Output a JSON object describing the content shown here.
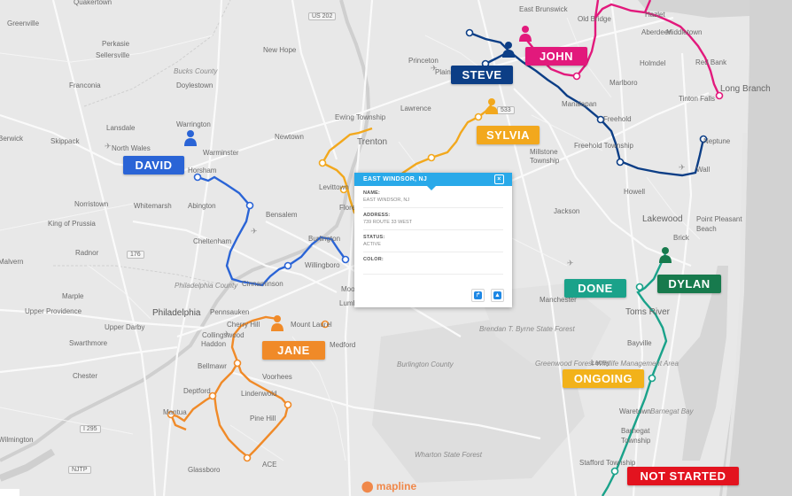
{
  "colors": {
    "david": "#2a64d6",
    "steve": "#0c3e86",
    "john": "#e2197c",
    "sylvia": "#f2a81d",
    "jane": "#f08a28",
    "dylan": "#177a4d",
    "done": "#1aa28a",
    "ongoing": "#f2b21a",
    "not_started": "#e3131f",
    "popup_header": "#29a9e9"
  },
  "reps": {
    "david": "DAVID",
    "steve": "STEVE",
    "john": "JOHN",
    "sylvia": "SYLVIA",
    "jane": "JANE",
    "dylan": "DYLAN"
  },
  "status_labels": {
    "done": "DONE",
    "ongoing": "ONGOING",
    "not_started": "NOT STARTED"
  },
  "popup": {
    "title": "EAST WINDSOR, NJ",
    "fields": [
      {
        "key": "NAME:",
        "value": "EAST WINDSOR, NJ"
      },
      {
        "key": "ADDRESS:",
        "value": "739 ROUTE 33 WEST"
      },
      {
        "key": "STATUS:",
        "value": "ACTIVE"
      },
      {
        "key": "COLOR:",
        "value": ""
      }
    ]
  },
  "brand": "mapline",
  "places": [
    {
      "name": "Quakertown",
      "cls": ""
    },
    {
      "name": "Greenville",
      "cls": ""
    },
    {
      "name": "Perkasie",
      "cls": ""
    },
    {
      "name": "Sellersville",
      "cls": ""
    },
    {
      "name": "Franconia",
      "cls": ""
    },
    {
      "name": "Bucks County",
      "cls": "it"
    },
    {
      "name": "Doylestown",
      "cls": ""
    },
    {
      "name": "New Hope",
      "cls": ""
    },
    {
      "name": "Princeton",
      "cls": ""
    },
    {
      "name": "Plainsboro",
      "cls": ""
    },
    {
      "name": "East Brunswick",
      "cls": ""
    },
    {
      "name": "Old Bridge",
      "cls": ""
    },
    {
      "name": "Hazlet",
      "cls": ""
    },
    {
      "name": "Aberdeen",
      "cls": ""
    },
    {
      "name": "Middletown",
      "cls": ""
    },
    {
      "name": "Holmdel",
      "cls": ""
    },
    {
      "name": "Red Bank",
      "cls": ""
    },
    {
      "name": "Long Branch",
      "cls": "lg"
    },
    {
      "name": "Tinton Falls",
      "cls": ""
    },
    {
      "name": "Marlboro",
      "cls": ""
    },
    {
      "name": "Manalapan",
      "cls": ""
    },
    {
      "name": "Freehold",
      "cls": ""
    },
    {
      "name": "Freehold Township",
      "cls": ""
    },
    {
      "name": "Neptune",
      "cls": ""
    },
    {
      "name": "Wall",
      "cls": ""
    },
    {
      "name": "Howell",
      "cls": ""
    },
    {
      "name": "Jackson",
      "cls": ""
    },
    {
      "name": "Lakewood",
      "cls": "lg"
    },
    {
      "name": "Point Pleasant",
      "cls": ""
    },
    {
      "name": "Beach",
      "cls": ""
    },
    {
      "name": "Brick",
      "cls": ""
    },
    {
      "name": "Toms River",
      "cls": "lg"
    },
    {
      "name": "Manchester",
      "cls": ""
    },
    {
      "name": "Bayville",
      "cls": ""
    },
    {
      "name": "Lacey",
      "cls": ""
    },
    {
      "name": "Waretown",
      "cls": ""
    },
    {
      "name": "Barnegat",
      "cls": ""
    },
    {
      "name": "Township",
      "cls": ""
    },
    {
      "name": "Barnegat Bay",
      "cls": "it"
    },
    {
      "name": "Stafford Township",
      "cls": ""
    },
    {
      "name": "Millstone",
      "cls": ""
    },
    {
      "name": "Township",
      "cls": ""
    },
    {
      "name": "Lawrence",
      "cls": ""
    },
    {
      "name": "Ewing Township",
      "cls": ""
    },
    {
      "name": "Trenton",
      "cls": "lg"
    },
    {
      "name": "Newtown",
      "cls": ""
    },
    {
      "name": "Warrington",
      "cls": ""
    },
    {
      "name": "Warminster",
      "cls": ""
    },
    {
      "name": "Lansdale",
      "cls": ""
    },
    {
      "name": "North Wales",
      "cls": ""
    },
    {
      "name": "Skippack",
      "cls": ""
    },
    {
      "name": "Horsham",
      "cls": ""
    },
    {
      "name": "Abington",
      "cls": ""
    },
    {
      "name": "Whitemarsh",
      "cls": ""
    },
    {
      "name": "Norristown",
      "cls": ""
    },
    {
      "name": "King of Prussia",
      "cls": ""
    },
    {
      "name": "Radnor",
      "cls": ""
    },
    {
      "name": "Bensalem",
      "cls": ""
    },
    {
      "name": "Cheltenham",
      "cls": ""
    },
    {
      "name": "Burlington",
      "cls": ""
    },
    {
      "name": "Willingboro",
      "cls": ""
    },
    {
      "name": "Cinnaminson",
      "cls": ""
    },
    {
      "name": "Levittown",
      "cls": ""
    },
    {
      "name": "Florence",
      "cls": ""
    },
    {
      "name": "Philadelphia County",
      "cls": "it"
    },
    {
      "name": "Philadelphia",
      "cls": "big"
    },
    {
      "name": "Pennsauken",
      "cls": ""
    },
    {
      "name": "Mount Laurel",
      "cls": ""
    },
    {
      "name": "Cherry Hill",
      "cls": ""
    },
    {
      "name": "Collingswood",
      "cls": ""
    },
    {
      "name": "Haddon",
      "cls": ""
    },
    {
      "name": "Bellmawr",
      "cls": ""
    },
    {
      "name": "Voorhees",
      "cls": ""
    },
    {
      "name": "Medford",
      "cls": ""
    },
    {
      "name": "Marple",
      "cls": ""
    },
    {
      "name": "Upper Providence",
      "cls": ""
    },
    {
      "name": "Upper Darby",
      "cls": ""
    },
    {
      "name": "Swarthmore",
      "cls": ""
    },
    {
      "name": "Chester",
      "cls": ""
    },
    {
      "name": "Deptford",
      "cls": ""
    },
    {
      "name": "Lindenwold",
      "cls": ""
    },
    {
      "name": "Mantua",
      "cls": ""
    },
    {
      "name": "Pine Hill",
      "cls": ""
    },
    {
      "name": "Glassboro",
      "cls": ""
    },
    {
      "name": "ACE",
      "cls": ""
    },
    {
      "name": "Burlington County",
      "cls": "it"
    },
    {
      "name": "Wharton State Forest",
      "cls": "it"
    },
    {
      "name": "Brendan T. Byrne State Forest",
      "cls": "it"
    },
    {
      "name": "Greenwood Forest Wildlife Management Area",
      "cls": "it"
    },
    {
      "name": "Lumberton",
      "cls": ""
    },
    {
      "name": "Moorestown",
      "cls": ""
    },
    {
      "name": "Malvern",
      "cls": ""
    },
    {
      "name": "Berwick",
      "cls": ""
    },
    {
      "name": "Wilmington",
      "cls": ""
    },
    {
      "name": "US 202",
      "cls": "road"
    },
    {
      "name": "176",
      "cls": "road"
    },
    {
      "name": "I 295",
      "cls": "road"
    },
    {
      "name": "NJTP",
      "cls": "road"
    },
    {
      "name": "533",
      "cls": "road"
    }
  ]
}
